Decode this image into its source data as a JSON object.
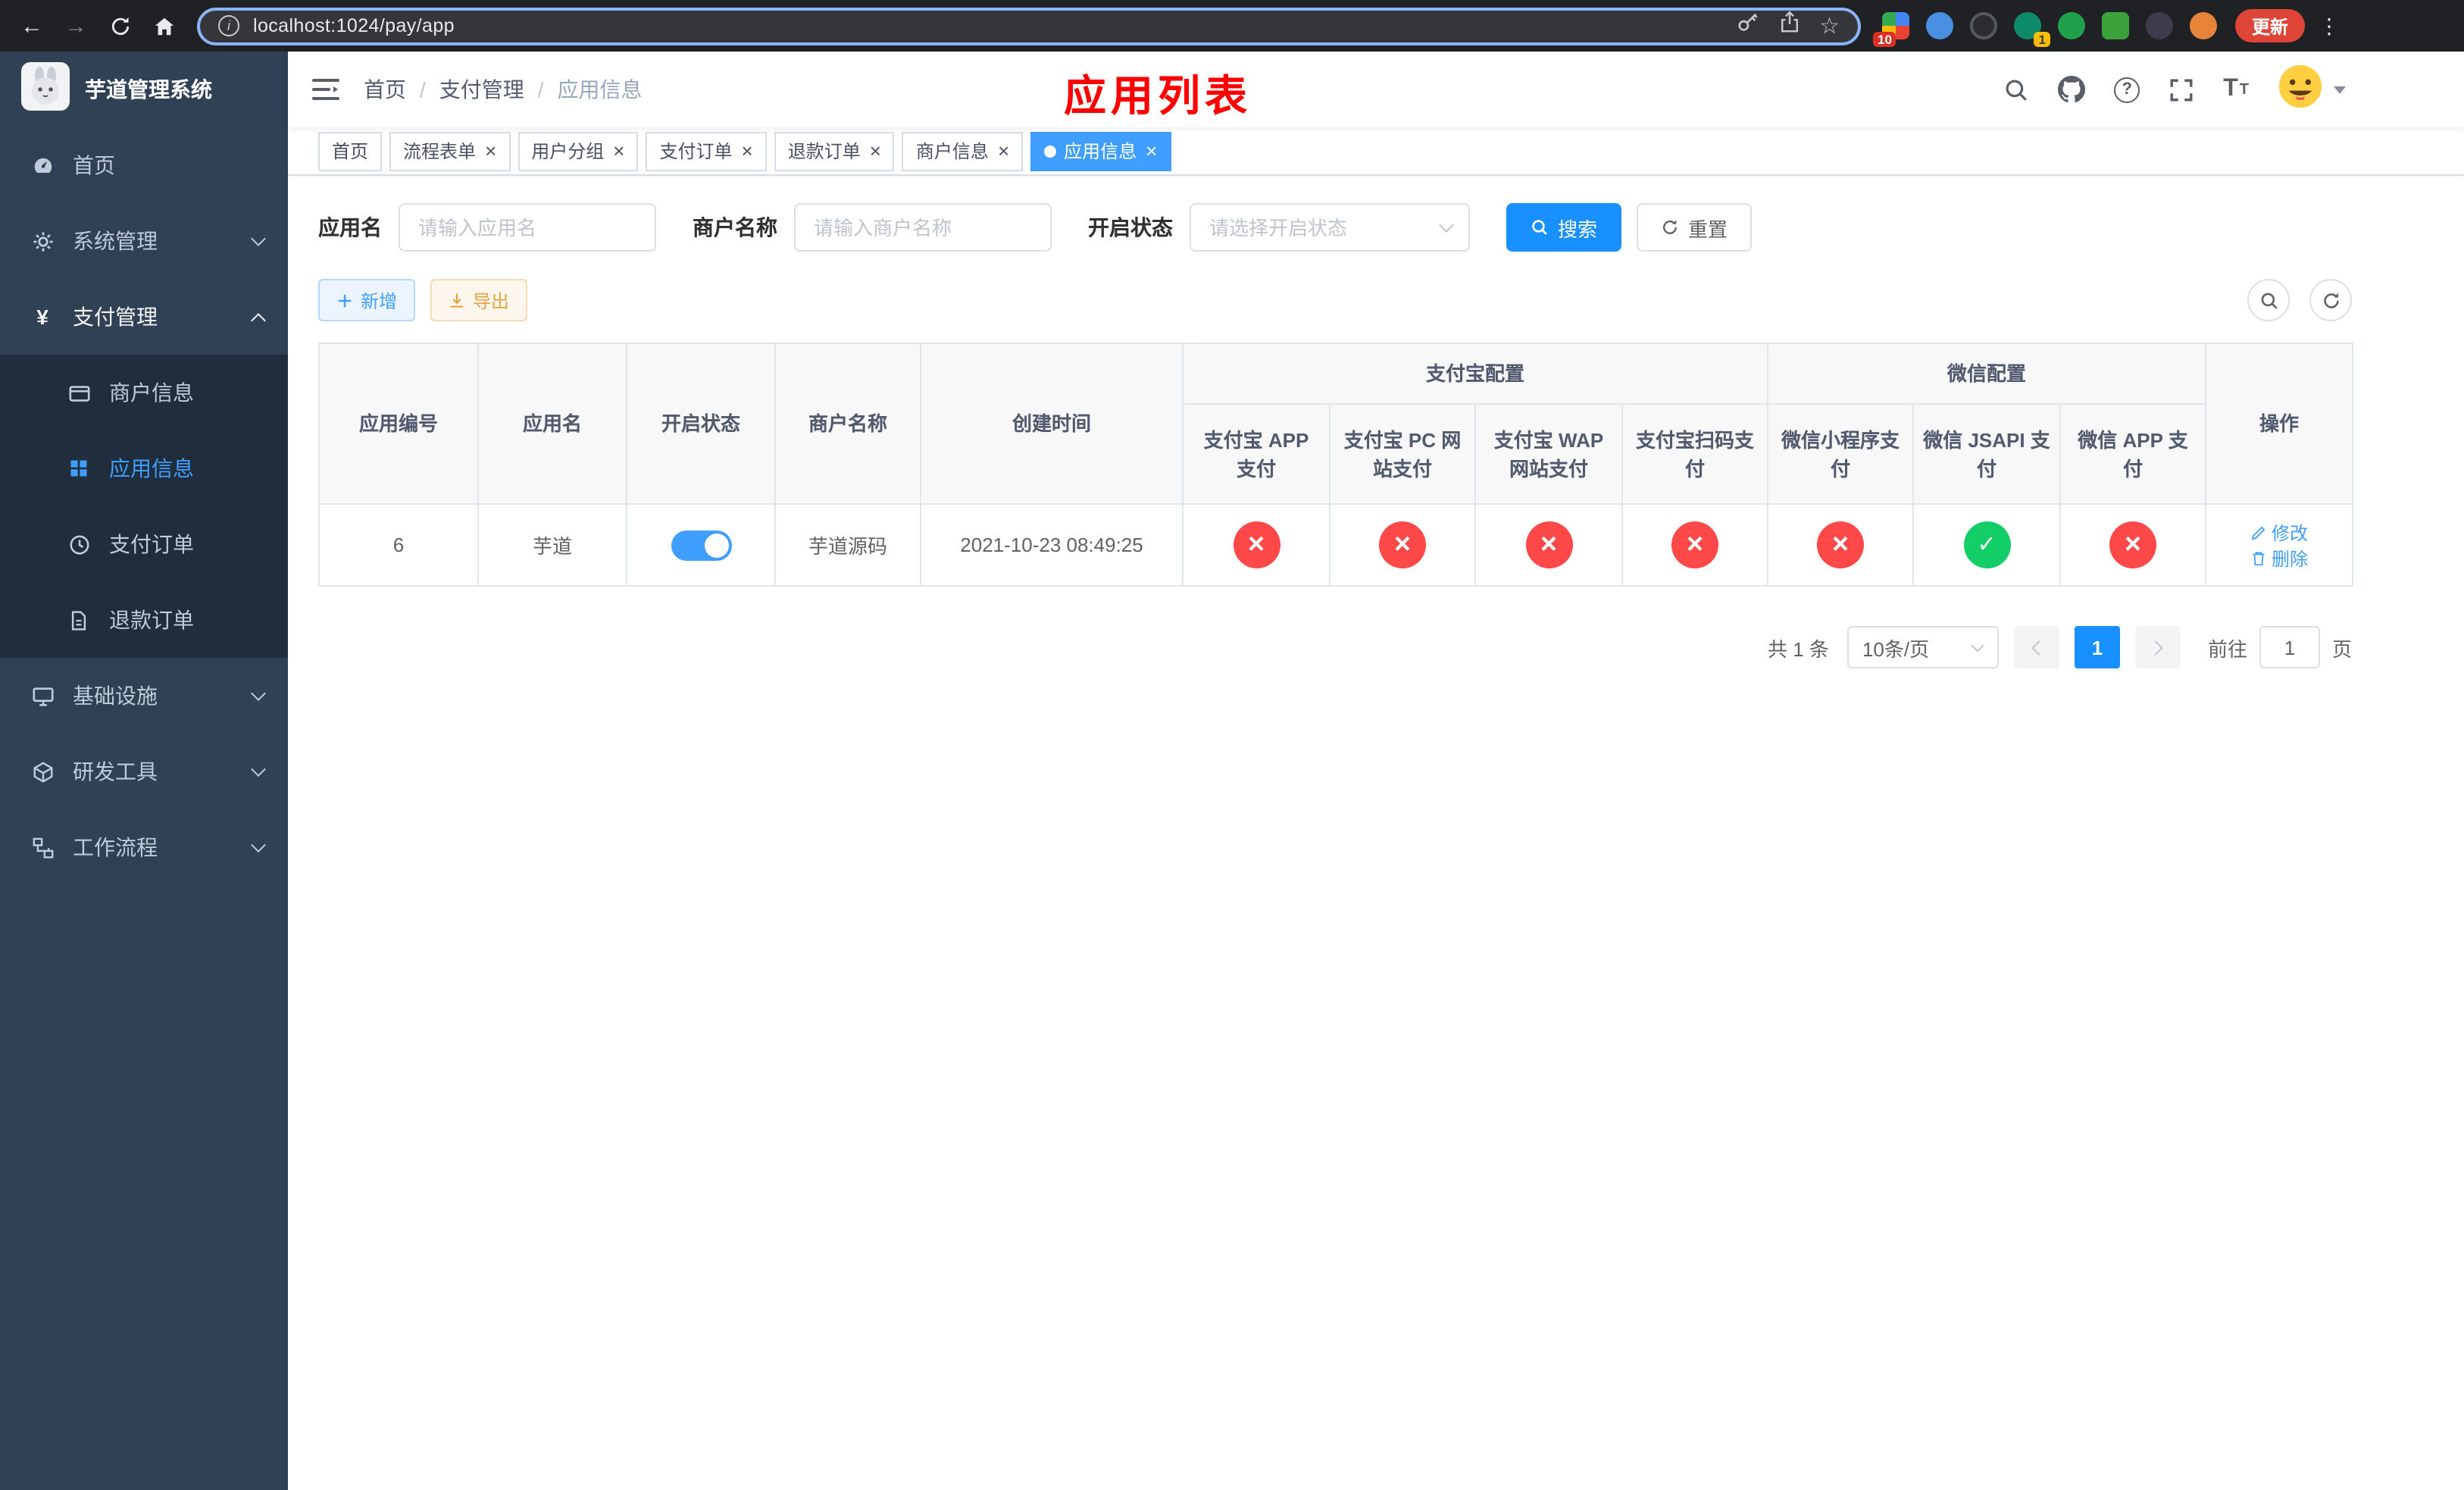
{
  "colors": {
    "primary": "#409eff",
    "primary-deep": "#1890ff",
    "success": "#13ce66",
    "danger": "#ff4949",
    "warning": "#e6a23c",
    "title-red": "#ff0000",
    "sidebar-bg": "#304156",
    "submenu-bg": "#1f2d3d",
    "browser-bg": "#202124"
  },
  "browser": {
    "url": "localhost:1024/pay/app",
    "extensions_badge": "10",
    "extension_badge": "1",
    "update_label": "更新"
  },
  "sidebar": {
    "title": "芋道管理系统",
    "menu": [
      {
        "label": "首页"
      },
      {
        "label": "系统管理"
      },
      {
        "label": "支付管理",
        "state": "expanded"
      },
      {
        "label": "基础设施"
      },
      {
        "label": "研发工具"
      },
      {
        "label": "工作流程"
      }
    ],
    "submenu": [
      {
        "label": "商户信息"
      },
      {
        "label": "应用信息",
        "state": "active"
      },
      {
        "label": "支付订单"
      },
      {
        "label": "退款订单"
      }
    ]
  },
  "navbar": {
    "breadcrumb": [
      {
        "label": "首页"
      },
      {
        "label": "支付管理"
      },
      {
        "label": "应用信息"
      }
    ],
    "title": "应用列表"
  },
  "tabs": [
    {
      "label": "首页"
    },
    {
      "label": "流程表单"
    },
    {
      "label": "用户分组"
    },
    {
      "label": "支付订单"
    },
    {
      "label": "退款订单"
    },
    {
      "label": "商户信息"
    },
    {
      "label": "应用信息",
      "state": "active"
    }
  ],
  "filters": {
    "app_name_label": "应用名",
    "app_name_placeholder": "请输入应用名",
    "merchant_label": "商户名称",
    "merchant_placeholder": "请输入商户名称",
    "status_label": "开启状态",
    "status_placeholder": "请选择开启状态",
    "search_label": "搜索",
    "reset_label": "重置"
  },
  "toolbar": {
    "add_label": "新增",
    "export_label": "导出"
  },
  "table": {
    "col_app_id": "应用编号",
    "col_app_name": "应用名",
    "col_status": "开启状态",
    "col_merchant": "商户名称",
    "col_created": "创建时间",
    "group_alipay": "支付宝配置",
    "group_wechat": "微信配置",
    "col_alipay_app": "支付宝 APP 支付",
    "col_alipay_pc": "支付宝 PC 网站支付",
    "col_alipay_wap": "支付宝 WAP 网站支付",
    "col_alipay_scan": "支付宝扫码支付",
    "col_wechat_mini": "微信小程序支付",
    "col_wechat_jsapi": "微信 JSAPI 支付",
    "col_wechat_app": "微信 APP 支付",
    "col_operation": "操作",
    "row": {
      "id": "6",
      "name": "芋道",
      "status": "on",
      "merchant": "芋道源码",
      "created": "2021-10-23 08:49:25",
      "configs": [
        "no",
        "no",
        "no",
        "no",
        "no",
        "yes",
        "no"
      ],
      "edit_label": "修改",
      "delete_label": "删除"
    }
  },
  "pagination": {
    "total": "共 1 条",
    "page_size": "10条/页",
    "page": "1",
    "goto_label": "前往",
    "goto_value": "1",
    "unit_label": "页"
  }
}
